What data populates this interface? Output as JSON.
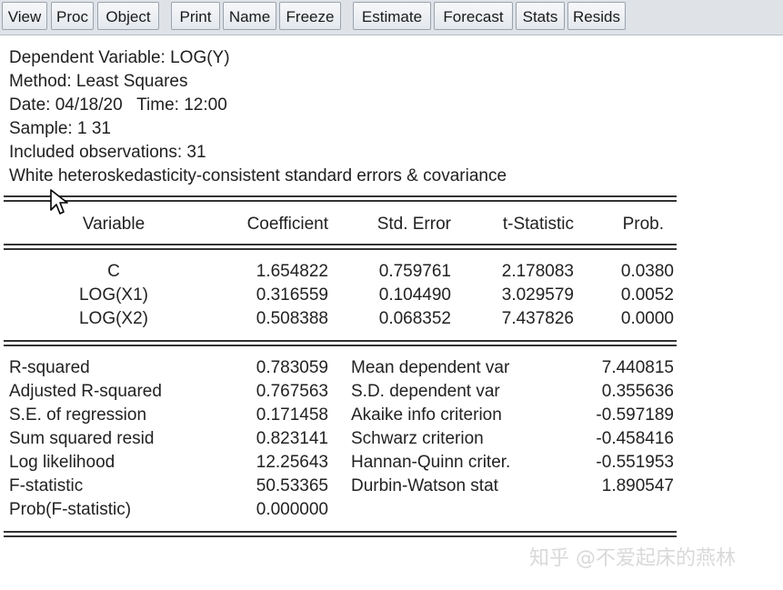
{
  "toolbar": {
    "buttons": [
      "View",
      "Proc",
      "Object",
      "Print",
      "Name",
      "Freeze",
      "Estimate",
      "Forecast",
      "Stats",
      "Resids"
    ]
  },
  "header": {
    "dependent": "Dependent Variable: LOG(Y)",
    "method": "Method: Least Squares",
    "datetime": "Date: 04/18/20   Time: 12:00",
    "sample": "Sample: 1 31",
    "observations": "Included observations: 31",
    "errors_note": "White heteroskedasticity-consistent standard errors & covariance"
  },
  "coef_table": {
    "columns": [
      "Variable",
      "Coefficient",
      "Std. Error",
      "t-Statistic",
      "Prob."
    ],
    "rows": [
      {
        "variable": "C",
        "coefficient": "1.654822",
        "std_error": "0.759761",
        "t_stat": "2.178083",
        "prob": "0.0380"
      },
      {
        "variable": "LOG(X1)",
        "coefficient": "0.316559",
        "std_error": "0.104490",
        "t_stat": "3.029579",
        "prob": "0.0052"
      },
      {
        "variable": "LOG(X2)",
        "coefficient": "0.508388",
        "std_error": "0.068352",
        "t_stat": "7.437826",
        "prob": "0.0000"
      }
    ]
  },
  "stats": {
    "left": [
      {
        "label": "R-squared",
        "value": "0.783059"
      },
      {
        "label": "Adjusted R-squared",
        "value": "0.767563"
      },
      {
        "label": "S.E. of regression",
        "value": "0.171458"
      },
      {
        "label": "Sum squared resid",
        "value": "0.823141"
      },
      {
        "label": "Log likelihood",
        "value": "12.25643"
      },
      {
        "label": "F-statistic",
        "value": "50.53365"
      },
      {
        "label": "Prob(F-statistic)",
        "value": "0.000000"
      }
    ],
    "right": [
      {
        "label": "Mean dependent var",
        "value": "7.440815"
      },
      {
        "label": "S.D. dependent var",
        "value": "0.355636"
      },
      {
        "label": "Akaike info criterion",
        "value": "-0.597189"
      },
      {
        "label": "Schwarz criterion",
        "value": "-0.458416"
      },
      {
        "label": "Hannan-Quinn criter.",
        "value": "-0.551953"
      },
      {
        "label": "Durbin-Watson stat",
        "value": "1.890547"
      }
    ]
  },
  "watermark": "知乎 @不爱起床的燕林",
  "cursor_icon": "arrow-pointer"
}
